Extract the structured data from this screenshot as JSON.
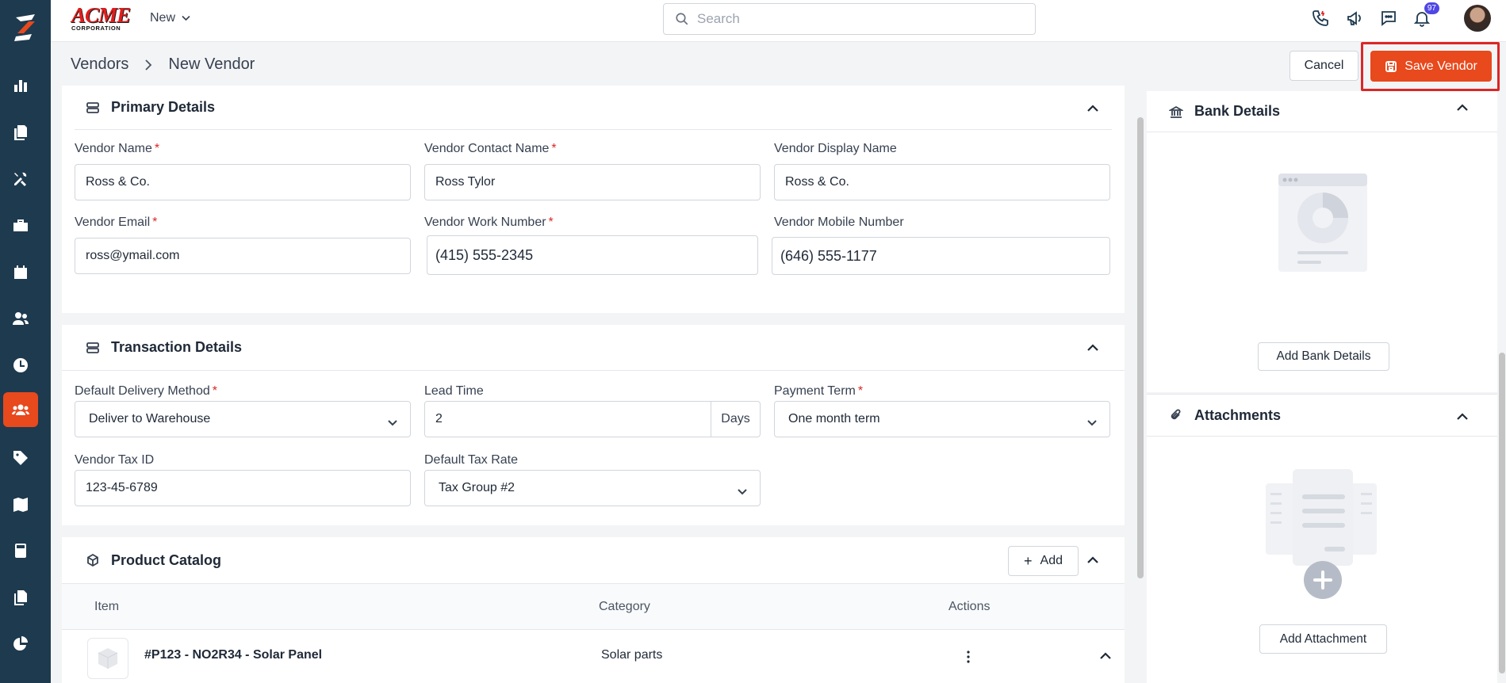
{
  "brand": {
    "name": "ACME",
    "sub": "CORPORATION"
  },
  "topbar": {
    "new_label": "New",
    "search_placeholder": "Search",
    "notification_count": "97"
  },
  "breadcrumb": {
    "parent": "Vendors",
    "current": "New Vendor"
  },
  "actions": {
    "cancel": "Cancel",
    "save": "Save Vendor"
  },
  "primary_details": {
    "title": "Primary Details",
    "fields": {
      "vendor_name": {
        "label": "Vendor Name",
        "value": "Ross & Co."
      },
      "contact_name": {
        "label": "Vendor Contact Name",
        "value": "Ross Tylor"
      },
      "display_name": {
        "label": "Vendor Display Name",
        "value": "Ross & Co."
      },
      "email": {
        "label": "Vendor Email",
        "value": "ross@ymail.com"
      },
      "work_number": {
        "label": "Vendor Work Number",
        "value": "(415) 555-2345"
      },
      "mobile_number": {
        "label": "Vendor Mobile Number",
        "value": "(646) 555-1177"
      }
    }
  },
  "transaction_details": {
    "title": "Transaction Details",
    "fields": {
      "delivery_method": {
        "label": "Default Delivery Method",
        "value": "Deliver to Warehouse"
      },
      "lead_time": {
        "label": "Lead Time",
        "value": "2",
        "unit": "Days"
      },
      "payment_term": {
        "label": "Payment Term",
        "value": "One month term"
      },
      "tax_id": {
        "label": "Vendor Tax ID",
        "value": "123-45-6789"
      },
      "tax_rate": {
        "label": "Default Tax Rate",
        "value": "Tax Group #2"
      }
    }
  },
  "product_catalog": {
    "title": "Product Catalog",
    "add_label": "Add",
    "columns": [
      "Item",
      "Category",
      "Actions"
    ],
    "rows": [
      {
        "item": "#P123 - NO2R34 - Solar Panel",
        "category": "Solar parts"
      }
    ]
  },
  "bank_details": {
    "title": "Bank Details",
    "button": "Add Bank Details"
  },
  "attachments": {
    "title": "Attachments",
    "button": "Add Attachment"
  },
  "colors": {
    "accent": "#e8491d",
    "sidebar": "#1e3a4f",
    "highlight": "#dc2626"
  },
  "icons": {
    "sidebar": [
      "dashboard-chart-icon",
      "documents-icon",
      "tools-icon",
      "briefcase-icon",
      "calendar-icon",
      "users-icon",
      "clock-icon",
      "vendors-icon",
      "tag-icon",
      "map-icon",
      "calculator-icon",
      "files-icon",
      "pie-chart-icon"
    ],
    "top": [
      "phone-icon",
      "megaphone-icon",
      "chat-icon",
      "bell-icon"
    ]
  }
}
